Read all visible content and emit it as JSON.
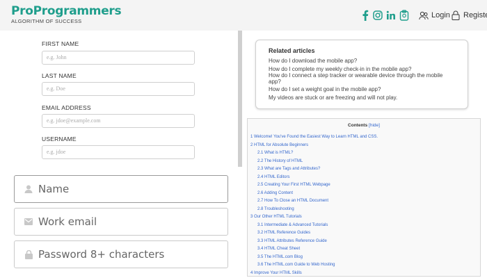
{
  "header": {
    "logo_title": "ProProgrammers",
    "logo_subtitle": "ALGORITHM OF SUCCESS",
    "social_icons": [
      "facebook-icon",
      "instagram-icon",
      "linkedin-icon",
      "clipboard-icon"
    ],
    "login_label": "Login",
    "register_label": "Register",
    "accent_color": "#1f9e8c"
  },
  "small_form": {
    "first_name": {
      "label": "FIRST NAME",
      "placeholder": "e.g. John"
    },
    "last_name": {
      "label": "LAST NAME",
      "placeholder": "e.g. Doe"
    },
    "email": {
      "label": "EMAIL ADDRESS",
      "placeholder": "e.g. jdoe@example.com"
    },
    "username": {
      "label": "USERNAME",
      "placeholder": "e.g. jdoe"
    }
  },
  "big_form": {
    "name_placeholder": "Name",
    "work_email_placeholder": "Work email",
    "password_placeholder": "Password 8+ characters"
  },
  "related": {
    "title": "Related articles",
    "items": [
      "How do I download the mobile app?",
      "How do I complete my weekly check-in in the mobile app?",
      "How do I connect a step tracker or wearable device through the mobile app?",
      "How do I set a weight goal in the mobile app?",
      "My videos are stuck or are freezing and will not play."
    ]
  },
  "toc": {
    "title": "Contents",
    "hide_label": "[hide]",
    "items": [
      {
        "text": "1 Welcome! You've Found the Easiest Way to Learn HTML and CSS.",
        "level": 1
      },
      {
        "text": "2 HTML for Absolute Beginners",
        "level": 1
      },
      {
        "text": "2.1 What is HTML?",
        "level": 2
      },
      {
        "text": "2.2 The History of HTML",
        "level": 2
      },
      {
        "text": "2.3 What are Tags and Attributes?",
        "level": 2
      },
      {
        "text": "2.4 HTML Editors",
        "level": 2
      },
      {
        "text": "2.5 Creating Your First HTML Webpage",
        "level": 2
      },
      {
        "text": "2.6 Adding Content",
        "level": 2
      },
      {
        "text": "2.7 How To Close an HTML Document",
        "level": 2
      },
      {
        "text": "2.8 Troubleshooting",
        "level": 2
      },
      {
        "text": "3 Our Other HTML Tutorials",
        "level": 1
      },
      {
        "text": "3.1 Intermediate & Advanced Tutorials",
        "level": 2
      },
      {
        "text": "3.2 HTML Reference Guides",
        "level": 2
      },
      {
        "text": "3.3 HTML Attributes Reference Guide",
        "level": 2
      },
      {
        "text": "3.4 HTML Cheat Sheet",
        "level": 2
      },
      {
        "text": "3.5 The HTML.com Blog",
        "level": 2
      },
      {
        "text": "3.6 The HTML.com Guide to Web Hosting",
        "level": 2
      },
      {
        "text": "4 Improve Your HTML Skills",
        "level": 1
      }
    ]
  }
}
